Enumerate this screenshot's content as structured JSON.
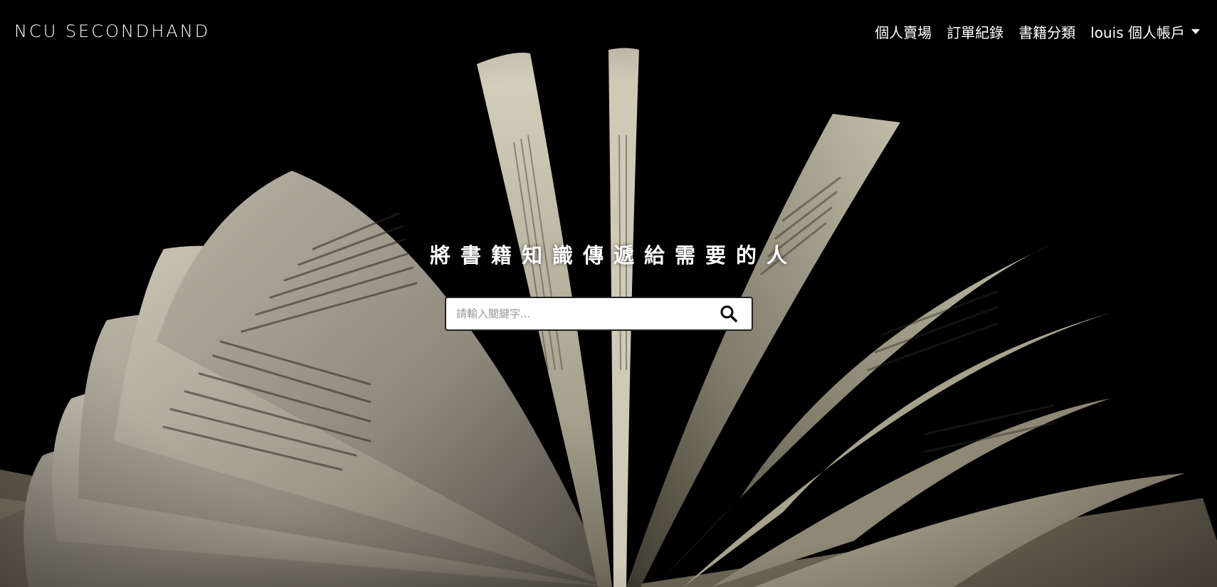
{
  "navbar": {
    "brand": "NCU SECONDHAND",
    "links": {
      "personal_store": "個人賣場",
      "orders": "訂單紀錄",
      "categories": "書籍分類",
      "account": "louis 個人帳戶"
    }
  },
  "hero": {
    "title": "將書籍知識傳遞給需要的人"
  },
  "search": {
    "placeholder": "請輸入關鍵字..."
  },
  "icons": {
    "search": "search-icon",
    "dropdown": "chevron-down-icon"
  },
  "colors": {
    "background": "#000000",
    "text": "#ffffff"
  }
}
